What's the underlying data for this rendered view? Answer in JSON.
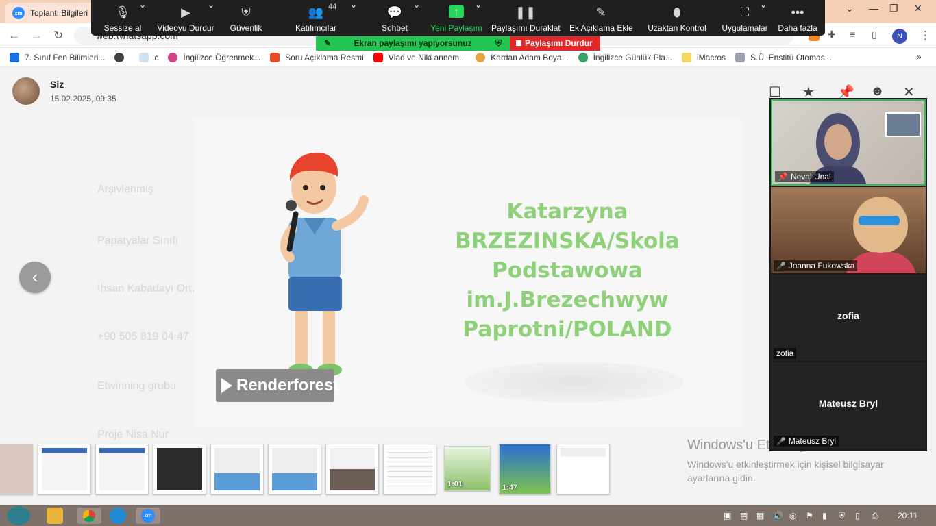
{
  "browser": {
    "tab_title": "Toplantı Bilgileri",
    "tab_icon": "zm",
    "url": "web.whatsapp.com",
    "profile_initial": "N"
  },
  "bookmarks": [
    {
      "label": "7. Sınıf Fen Bilimleri...",
      "color": "#1a73e8"
    },
    {
      "label": "",
      "color": "#444444"
    },
    {
      "label": "c",
      "color": "#7fb3e0"
    },
    {
      "label": "İngilizce Öğrenmek...",
      "color": "#d53f8c"
    },
    {
      "label": "Soru Açıklama Resmi",
      "color": "#e44d26"
    },
    {
      "label": "Vlad ve Niki annem...",
      "color": "#ff0000"
    },
    {
      "label": "Kardan Adam Boya...",
      "color": "#e8a33d"
    },
    {
      "label": "İngilizce Günlük Pla...",
      "color": "#38a169"
    },
    {
      "label": "iMacros",
      "color": "#f6d860"
    },
    {
      "label": "S.Ü. Enstitü Otomas...",
      "color": "#9aa5b1"
    }
  ],
  "zoom_toolbar": {
    "mute": "Sessize al",
    "video": "Videoyu Durdur",
    "security": "Güvenlik",
    "participants": "Katılımcılar",
    "participants_count": "44",
    "chat": "Sohbet",
    "new_share": "Yeni Paylaşım",
    "pause_share": "Paylaşımı Duraklat",
    "annotate": "Ek Açıklama Ekle",
    "remote_control": "Uzaktan Kontrol",
    "apps": "Uygulamalar",
    "more": "Daha fazla"
  },
  "sharing_banner": "Ekran paylaşımı yapıyorsunuz",
  "stop_share": "Paylaşımı Durdur",
  "viewer": {
    "sender_name": "Siz",
    "sender_time": "15.02.2025, 09:35"
  },
  "slide": {
    "lines": [
      "Katarzyna",
      "BRZEZINSKA/Skola",
      "Podstawowa",
      "im.J.Brezechwyw",
      "Paprotni/POLAND"
    ],
    "brand": "Renderforest"
  },
  "participants": [
    {
      "name": "Neval Unal",
      "muted": false,
      "pinned": true,
      "video": true
    },
    {
      "name": "Joanna Fukowska",
      "muted": true,
      "pinned": false,
      "video": true
    },
    {
      "name": "zofia",
      "muted": false,
      "pinned": false,
      "video": false,
      "center_name": "zofia"
    },
    {
      "name": "Mateusz Bryl",
      "muted": true,
      "pinned": false,
      "video": false,
      "center_name": "Mateusz Bryl"
    }
  ],
  "thumbnails": [
    {
      "duration": ""
    },
    {
      "duration": ""
    },
    {
      "duration": ""
    },
    {
      "duration": ""
    },
    {
      "duration": ""
    },
    {
      "duration": ""
    },
    {
      "duration": ""
    },
    {
      "duration": ""
    },
    {
      "duration": "1:01"
    },
    {
      "duration": "1:47"
    },
    {
      "duration": ""
    }
  ],
  "windows_activation": {
    "title": "Windows'u Etkinleştir",
    "subtitle": "Windows'u etkinleştirmek için kişisel bilgisayar ayarlarına gidin."
  },
  "taskbar": {
    "clock": "20:11"
  }
}
